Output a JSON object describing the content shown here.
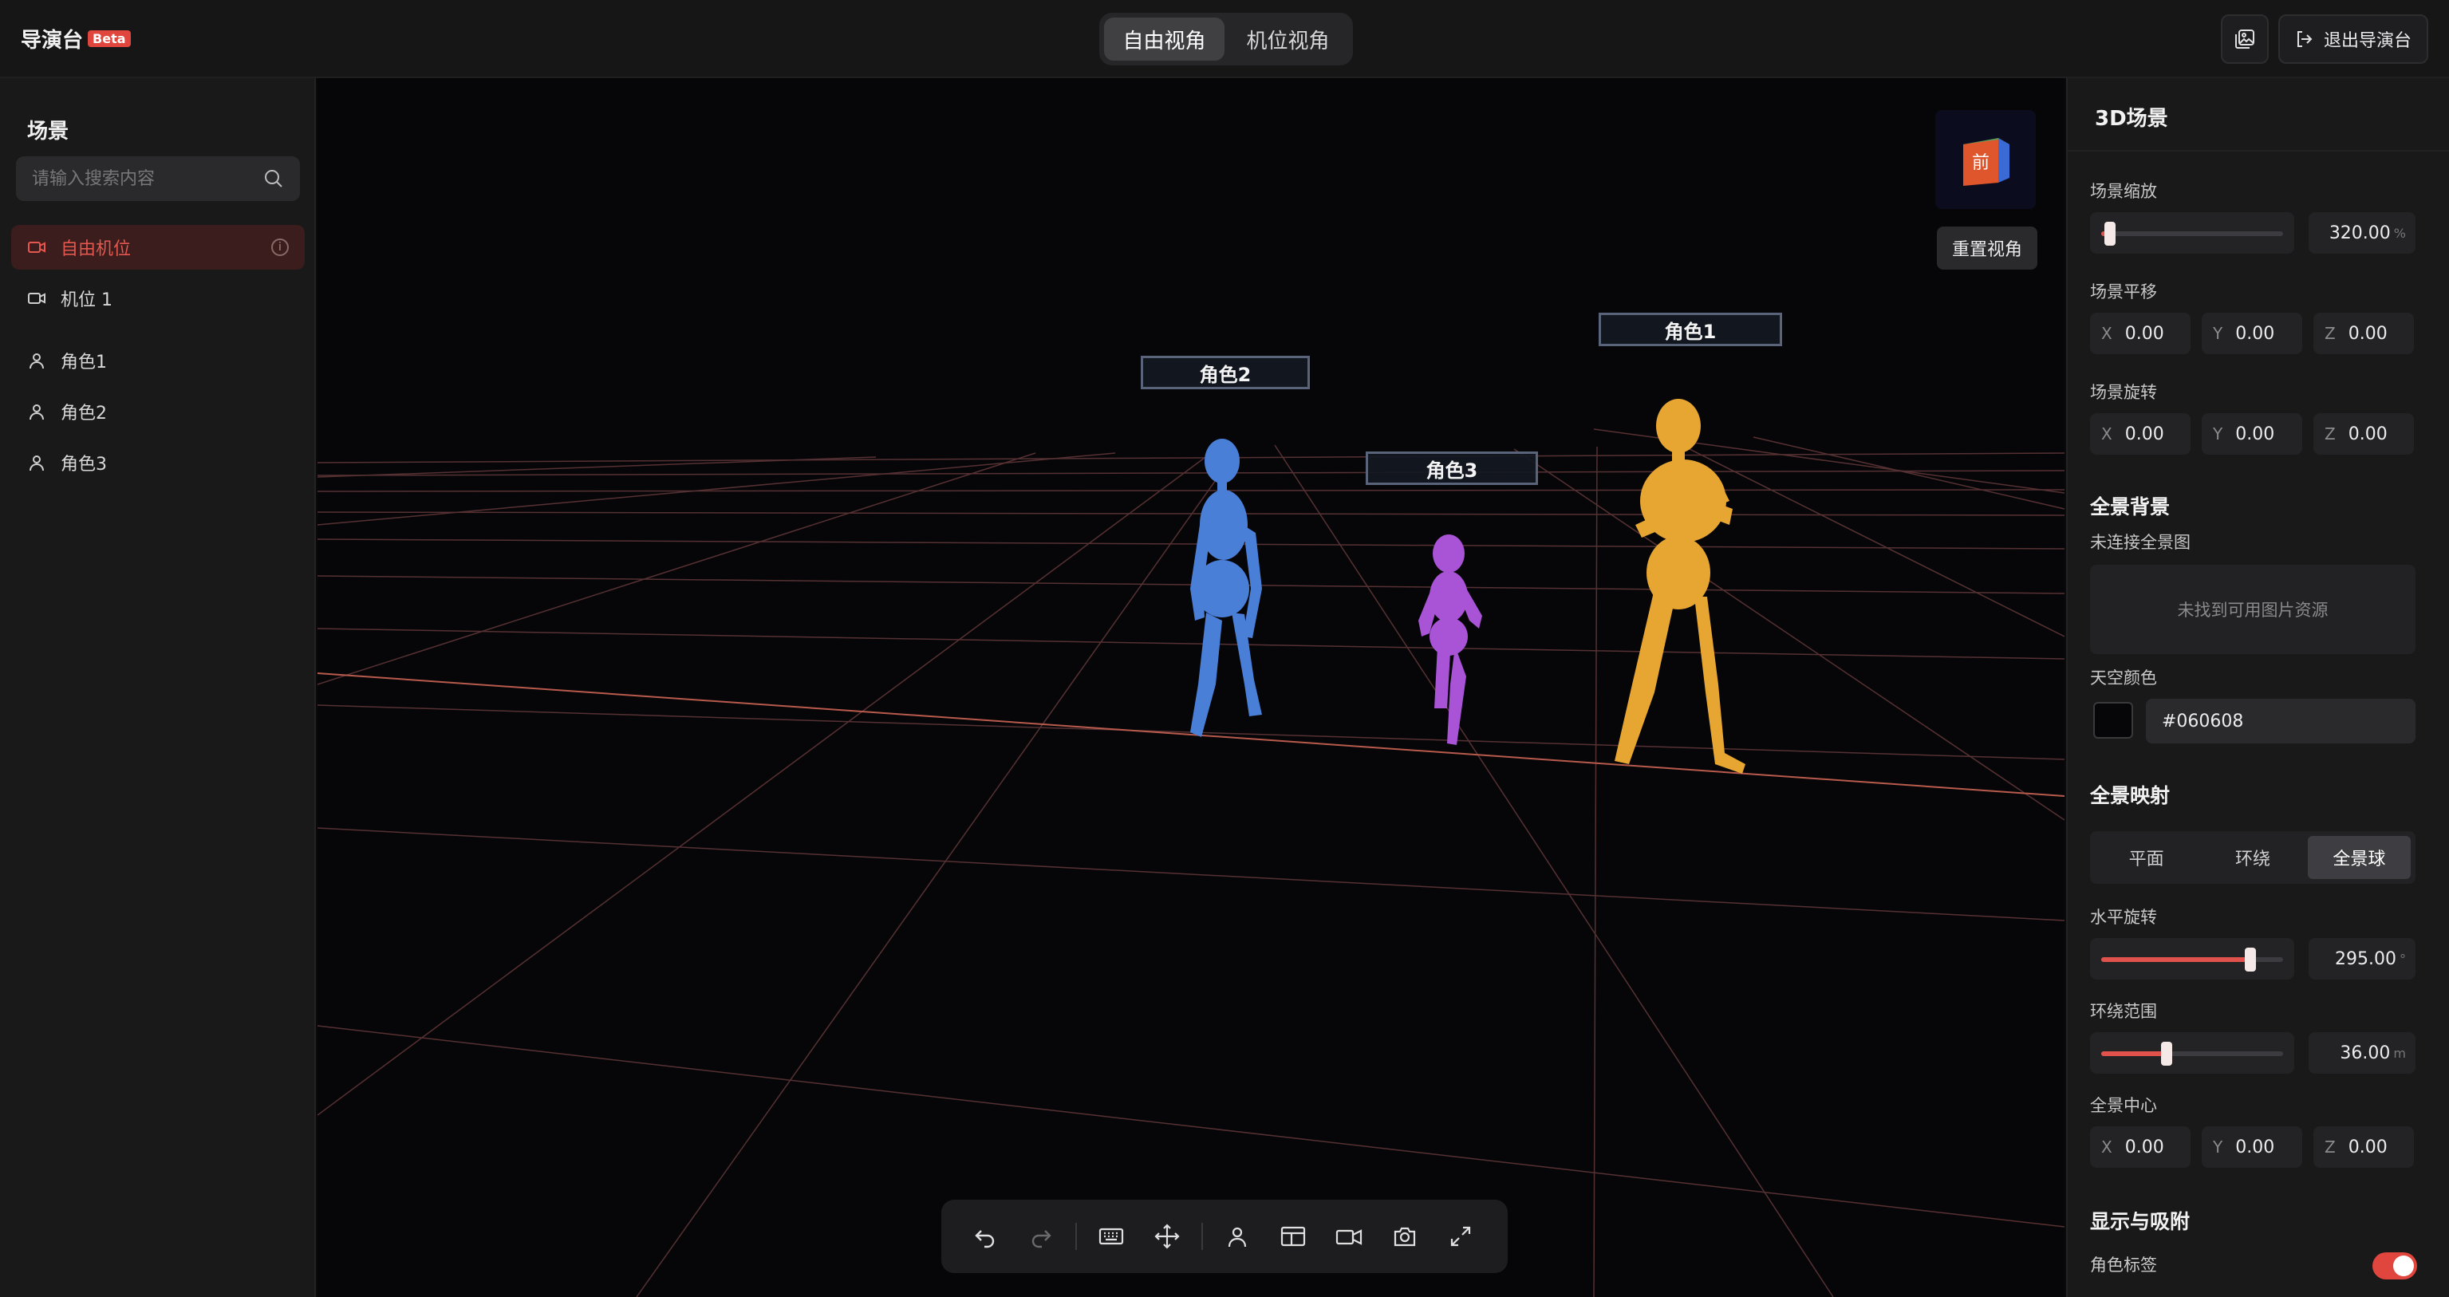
{
  "app": {
    "title": "导演台",
    "badge": "Beta"
  },
  "view_switch": {
    "tabs": [
      {
        "label": "自由视角",
        "active": true
      },
      {
        "label": "机位视角",
        "active": false
      }
    ]
  },
  "top_actions": {
    "gallery_icon": "image-gallery-icon",
    "exit_label": "退出导演台",
    "exit_icon": "exit-icon"
  },
  "left_panel": {
    "title": "场景",
    "search_placeholder": "请输入搜索内容",
    "items": [
      {
        "label": "自由机位",
        "icon": "camera-icon",
        "active": true,
        "info_icon": "i"
      },
      {
        "label": "机位 1",
        "icon": "camera-icon",
        "active": false
      },
      {
        "label": "角色1",
        "icon": "person-icon",
        "active": false
      },
      {
        "label": "角色2",
        "icon": "person-icon",
        "active": false
      },
      {
        "label": "角色3",
        "icon": "person-icon",
        "active": false
      }
    ]
  },
  "viewport": {
    "character_labels": [
      "角色1",
      "角色2",
      "角色3"
    ],
    "character_colors": {
      "角色1": "#e7a531",
      "角色2": "#4a7fd8",
      "角色3": "#a954d6"
    },
    "view_cube_face": "前",
    "reset_view_label": "重置视角",
    "background_color": "#060608",
    "grid_color": "#7a4a4a"
  },
  "toolbar": {
    "buttons": [
      "undo-icon",
      "redo-icon",
      "keyboard-icon",
      "move-icon",
      "person-icon",
      "layout-icon",
      "camera-icon",
      "screenshot-icon",
      "fullscreen-icon"
    ]
  },
  "right_panel": {
    "title": "3D场景",
    "scene_scale": {
      "label": "场景缩放",
      "value": "320.00",
      "unit": "%",
      "fraction": 0.05
    },
    "scene_translate": {
      "label": "场景平移",
      "x": "0.00",
      "y": "0.00",
      "z": "0.00"
    },
    "scene_rotate": {
      "label": "场景旋转",
      "x": "0.00",
      "y": "0.00",
      "z": "0.00"
    },
    "panorama_bg": {
      "title": "全景背景",
      "status": "未连接全景图",
      "empty_text": "未找到可用图片资源"
    },
    "sky_color": {
      "label": "天空颜色",
      "value": "#060608"
    },
    "panorama_mapping": {
      "title": "全景映射",
      "options": [
        "平面",
        "环绕",
        "全景球"
      ],
      "selected": "全景球"
    },
    "horizontal_rotation": {
      "label": "水平旋转",
      "value": "295.00",
      "unit": "°",
      "fraction": 0.82
    },
    "surround_range": {
      "label": "环绕范围",
      "value": "36.00",
      "unit": "m",
      "fraction": 0.36
    },
    "panorama_center": {
      "label": "全景中心",
      "x": "0.00",
      "y": "0.00",
      "z": "0.00"
    },
    "display_snap": {
      "title": "显示与吸附",
      "character_label": "角色标签",
      "character_label_on": true
    },
    "axes": {
      "x": "X",
      "y": "Y",
      "z": "Z"
    }
  }
}
